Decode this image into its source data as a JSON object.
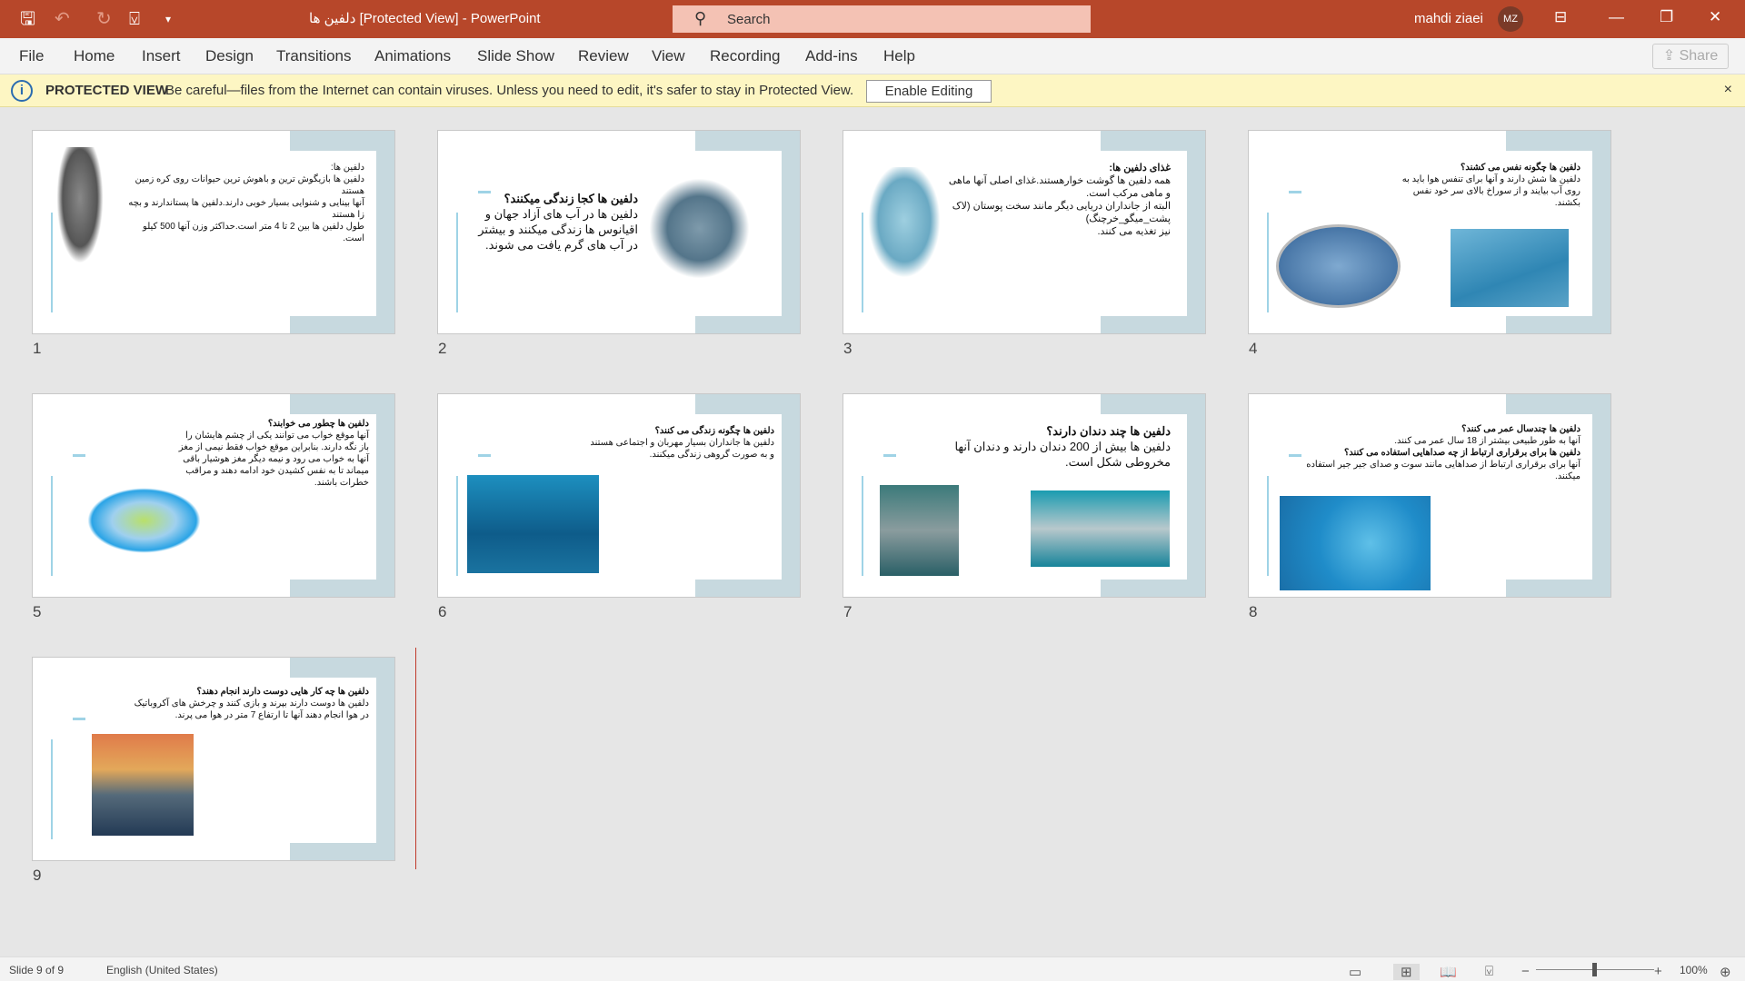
{
  "titlebar": {
    "doc_title": "دلفین ها [Protected View]  -  PowerPoint",
    "search_placeholder": "Search",
    "user_name": "mahdi ziaei",
    "user_initials": "MZ",
    "accent": "#b7472a"
  },
  "ribbon": {
    "tabs": [
      "File",
      "Home",
      "Insert",
      "Design",
      "Transitions",
      "Animations",
      "Slide Show",
      "Review",
      "View",
      "Recording",
      "Add-ins",
      "Help"
    ],
    "share": "Share"
  },
  "protected_view": {
    "label": "PROTECTED VIEW",
    "message": "Be careful—files from the Internet can contain viruses. Unless you need to edit, it's safer to stay in Protected View.",
    "button": "Enable Editing",
    "close": "×"
  },
  "slides": [
    {
      "num": "1",
      "title": "دلفین ها:",
      "body": "دلفین ها بازیگوش ترین و باهوش ترین حیوانات روی کره زمین هستند\nآنها بینایی و شنوایی بسیار خوبی دارند.دلفین ها پستاندارند و بچه زا هستند\nطول دلفین ها بین 2 تا 4 متر است.حداکثر وزن آنها 500 کیلو است."
    },
    {
      "num": "2",
      "title": "دلفین ها کجا زندگی میکنند؟",
      "body": "دلفین ها در آب های آزاد جهان و اقیانوس ها زندگی میکنند و بیشتر در آب های گرم یافت می شوند."
    },
    {
      "num": "3",
      "title": "غذای دلفین ها:",
      "body": "همه دلفین ها گوشت خوارهستند.غذای اصلی آنها ماهی و ماهی مرکب است.\nالبته از جانداران دریایی دیگر مانند سخت پوستان (لاک پشت_میگو_خرچنگ)\nنیز تغذیه می کنند."
    },
    {
      "num": "4",
      "title": "دلفین ها چگونه نفس می کشند؟",
      "body": "دلفین ها شش دارند و آنها برای تنفس هوا باید به روی آب بیایند و از سوراخ بالای سر خود نفس بکشند."
    },
    {
      "num": "5",
      "title": "دلفین ها چطور می خوابند؟",
      "body": "آنها موقع خواب می توانند یکی از چشم هایشان را باز نگه دارند. بنابراین موقع خواب فقط نیمی از مغز آنها به خواب می رود و نیمه دیگر مغز هوشیار باقی میماند تا به نفس کشیدن خود ادامه دهند و مراقب خطرات باشند."
    },
    {
      "num": "6",
      "title": "دلفین ها چگونه زندگی می کنند؟",
      "body": "دلفین ها جانداران بسیار مهربان و اجتماعی هستند و به صورت گروهی زندگی میکنند."
    },
    {
      "num": "7",
      "title": "دلفین ها چند دندان دارند؟",
      "body": "دلفین ها بیش از 200 دندان دارند و دندان آنها مخروطی شکل است."
    },
    {
      "num": "8",
      "title": "دلفین ها چندسال عمر می کنند؟",
      "body": "آنها به طور طبیعی بیشتر از 18 سال عمر می کنند.",
      "title2": "دلفین ها برای برقراری ارتباط از چه صداهایی استفاده می کنند؟",
      "body2": "آنها برای برقراری ارتباط از صداهایی مانند سوت و صدای جیر جیر استفاده میکنند."
    },
    {
      "num": "9",
      "title": "دلفین ها چه کار هایی دوست دارند انجام دهند؟",
      "body": "دلفین ها دوست دارند بپرند و بازی کنند و چرخش های آکروباتیک در هوا انجام دهند آنها تا ارتفاع  7 متر در هوا می پرند."
    }
  ],
  "status": {
    "slide": "Slide 9 of 9",
    "language": "English (United States)",
    "zoom": "100%"
  },
  "colors": {
    "slide_frame": "#c7d9df",
    "protected_bar": "#fdf6c3"
  }
}
